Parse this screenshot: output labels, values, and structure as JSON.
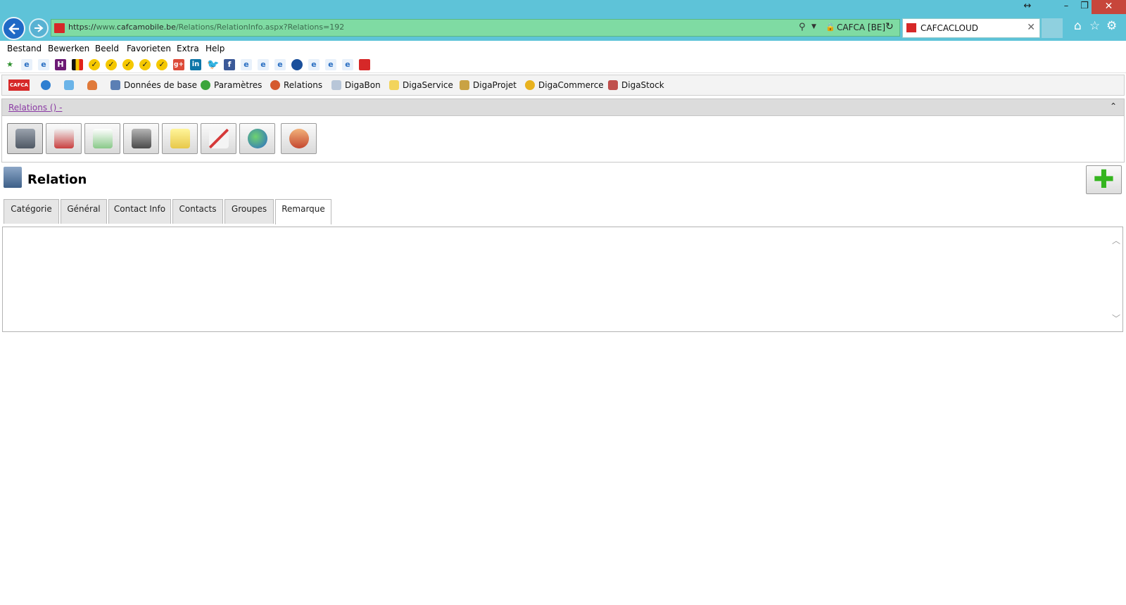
{
  "browser": {
    "address": {
      "scheme": "https://",
      "subdomain": "www.",
      "domain": "cafcamobile.be",
      "path": "/Relations/RelationInfo.aspx?Relations=192",
      "certificate": "CAFCA [BE]"
    },
    "tab_title": "CAFCACLOUD"
  },
  "menubar": {
    "items": [
      "Bestand",
      "Bewerken",
      "Beeld",
      "Favorieten",
      "Extra",
      "Help"
    ]
  },
  "app_menu": {
    "items": [
      "Données de base",
      "Paramètres",
      "Relations",
      "DigaBon",
      "DigaService",
      "DigaProjet",
      "DigaCommerce",
      "DigaStock"
    ]
  },
  "section": {
    "breadcrumb": "Relations () -"
  },
  "page": {
    "title": "Relation"
  },
  "tabs": [
    "Catégorie",
    "Général",
    "Contact Info",
    "Contacts",
    "Groupes",
    "Remarque"
  ],
  "active_tab": "Remarque",
  "remark": {
    "value": ""
  },
  "colors": {
    "accent": "#5ec3d8",
    "address_bar": "#7fdba3",
    "link": "#8b3aa4",
    "add_icon": "#35b51f"
  }
}
